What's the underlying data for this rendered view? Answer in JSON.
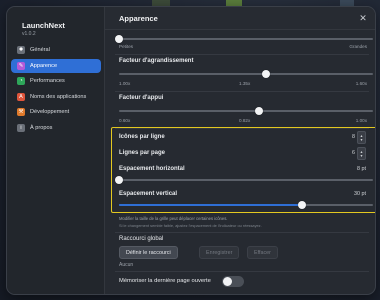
{
  "app": {
    "title": "LaunchNext",
    "version": "v1.0.2"
  },
  "sidebar": {
    "items": [
      {
        "label": "Général",
        "icon": "gear-icon",
        "color": "#6a6f78"
      },
      {
        "label": "Apparence",
        "icon": "paintbrush-icon",
        "color": "#b45ad8"
      },
      {
        "label": "Performances",
        "icon": "gauge-icon",
        "color": "#2ea65a"
      },
      {
        "label": "Noms des applications",
        "icon": "text-icon",
        "color": "#e0553b"
      },
      {
        "label": "Développement",
        "icon": "hammer-icon",
        "color": "#e07a2b"
      },
      {
        "label": "À propos",
        "icon": "info-icon",
        "color": "#6a6f78"
      }
    ],
    "active_index": 1
  },
  "header": {
    "title": "Apparence",
    "close_icon": "close-icon"
  },
  "icon_size": {
    "min_label": "Petites",
    "max_label": "Grandes",
    "level": 0.0
  },
  "zoom": {
    "label": "Facteur d'agrandissement",
    "min": "1.00x",
    "current": "1.35x",
    "max": "1.60x",
    "level": 0.58
  },
  "support": {
    "label": "Facteur d'appui",
    "min": "0.60x",
    "current": "0.82x",
    "max": "1.00x",
    "level": 0.55
  },
  "grid": {
    "icons_per_row": {
      "label": "Icônes par ligne",
      "value": "8"
    },
    "rows_per_page": {
      "label": "Lignes par page",
      "value": "6"
    },
    "horizontal_spacing": {
      "label": "Espacement horizontal",
      "value": "8 pt",
      "level": 0.0
    },
    "vertical_spacing": {
      "label": "Espacement vertical",
      "value": "30 pt",
      "level": 0.72
    },
    "help_line1": "Modifier la taille de la grille peut déplacer certaines icônes.",
    "help_line2": "Si le changement semble faible, ajustez l'espacement de l'indicateur ou réessayez."
  },
  "shortcut": {
    "title": "Raccourci global",
    "define_label": "Définir le raccourci",
    "save_label": "Enregistrer",
    "clear_label": "Effacer",
    "current": "Aucun"
  },
  "remember": {
    "label": "Mémoriser la dernière page ouverte",
    "enabled": false
  },
  "colors": {
    "accent": "#2f6fd6",
    "highlight": "#e3c820"
  }
}
